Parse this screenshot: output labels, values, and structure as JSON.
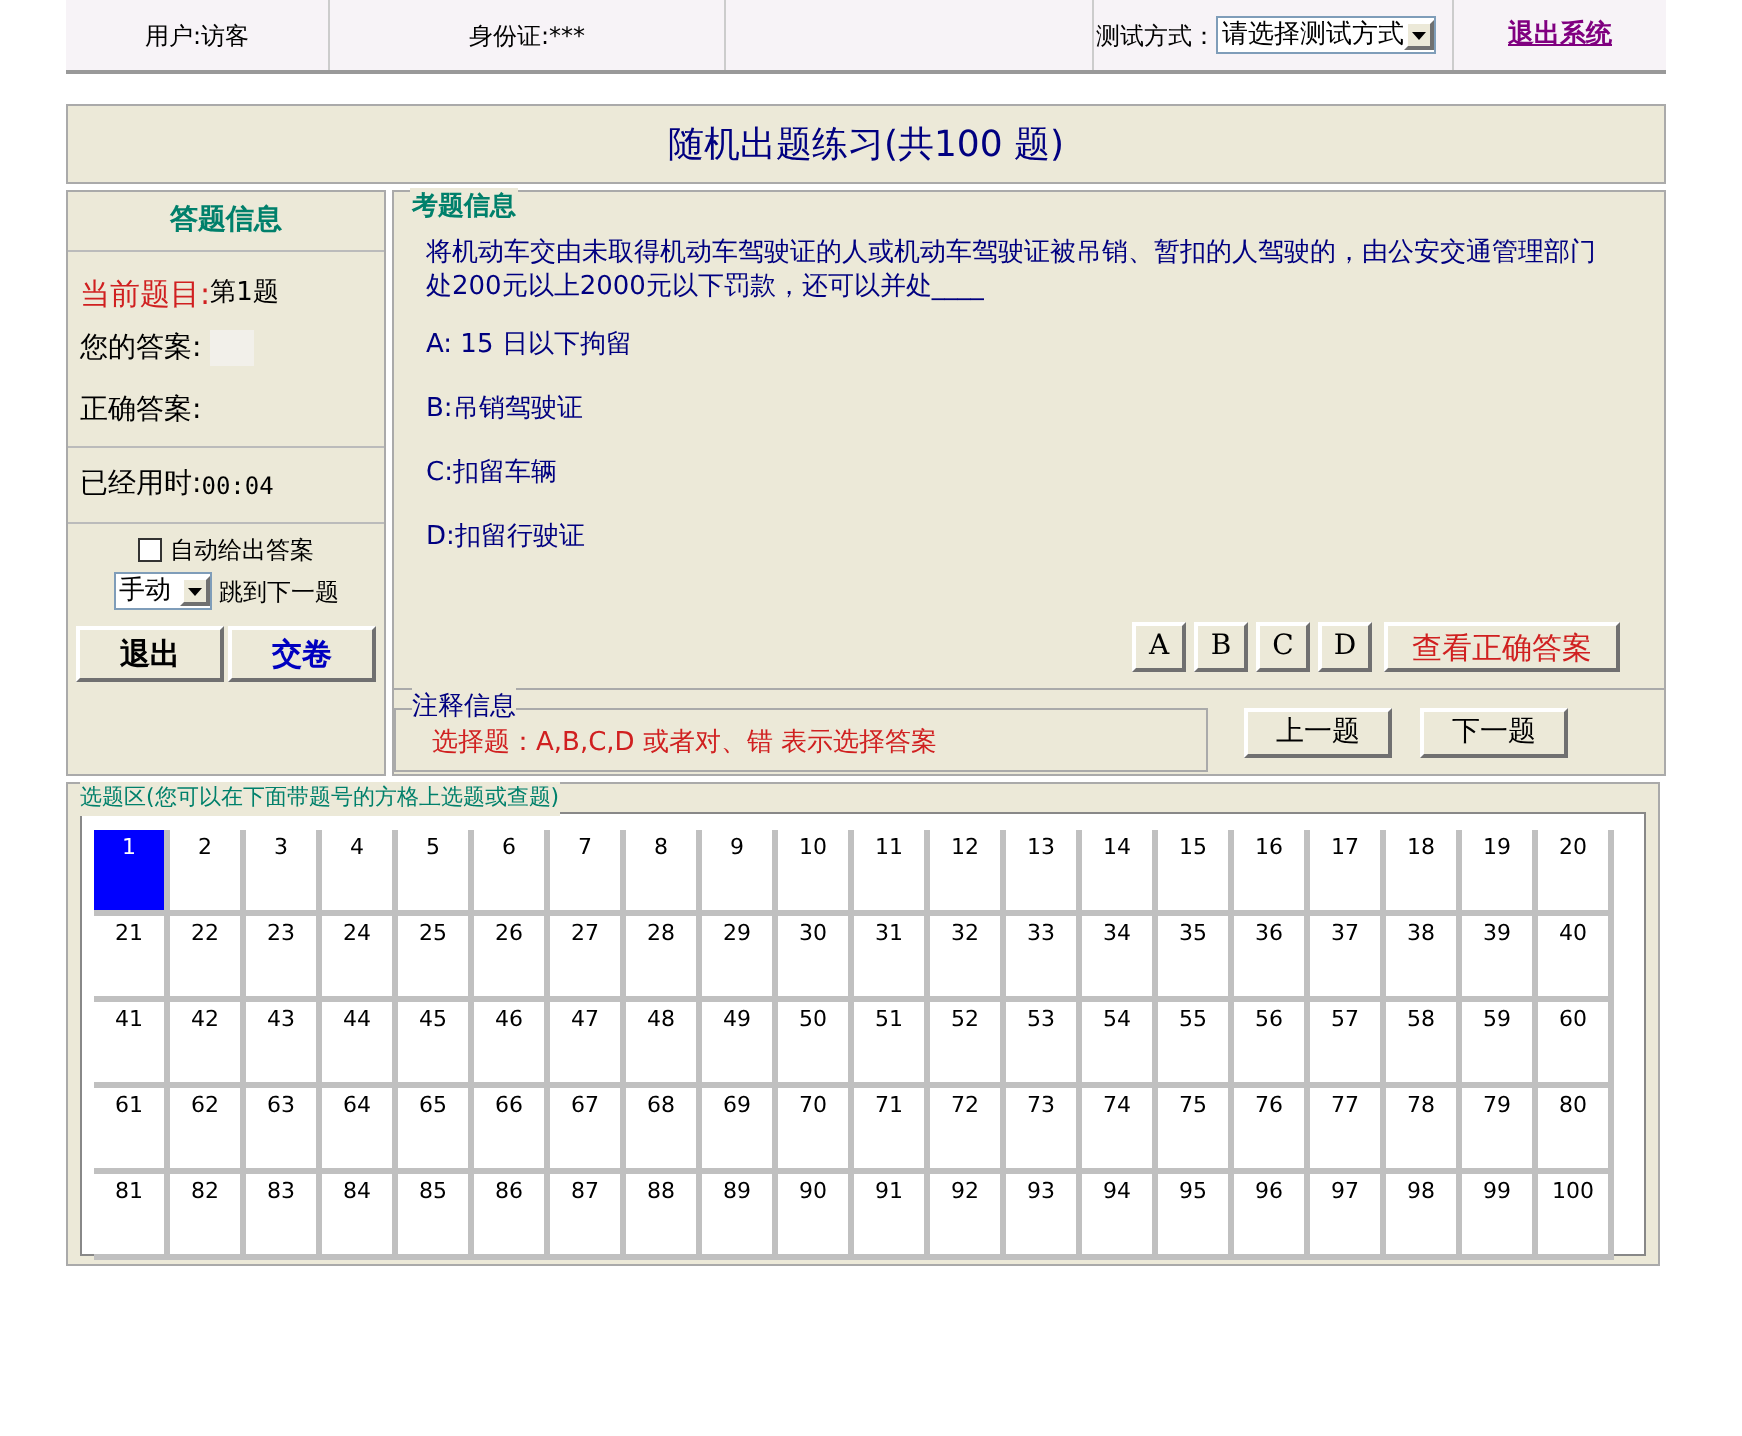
{
  "top_bar": {
    "user": "用户:访客",
    "id_card": "身份证:***",
    "test_mode_label": "测试方式：",
    "test_mode_select": "请选择测试方式",
    "logout_link": "退出系统"
  },
  "title": "随机出题练习(共100 题)",
  "answer_info": {
    "heading": "答题信息",
    "current_label": "当前题目:",
    "current_value": "第1题",
    "your_answer_label": "您的答案:",
    "correct_answer_label": "正确答案:",
    "elapsed_label": "已经用时:",
    "elapsed_value": "00:04",
    "auto_answer": {
      "label": "自动给出答案",
      "checked": false
    },
    "mode_select": "手动",
    "jump_label": "跳到下一题",
    "exit_button": "退出",
    "submit_button": "交卷"
  },
  "question": {
    "legend": "考题信息",
    "text": "将机动车交由未取得机动车驾驶证的人或机动车驾驶证被吊销、暂扣的人驾驶的，由公安交通管理部门处200元以上2000元以下罚款，还可以并处____",
    "options": [
      "A: 15 日以下拘留",
      "B:吊销驾驶证",
      "C:扣留车辆",
      "D:扣留行驶证"
    ],
    "answer_buttons": [
      "A",
      "B",
      "C",
      "D"
    ],
    "show_answer_button": "查看正确答案"
  },
  "notes": {
    "legend": "注释信息",
    "text": "选择题：A,B,C,D 或者对、错 表示选择答案"
  },
  "nav": {
    "prev_button": "上一题",
    "next_button": "下一题"
  },
  "grid": {
    "legend": "选题区(您可以在下面带题号的方格上选题或查题)",
    "cells": [
      {
        "label": "1",
        "selected": true
      },
      {
        "label": "2",
        "selected": false
      },
      {
        "label": "3",
        "selected": false
      },
      {
        "label": "4",
        "selected": false
      },
      {
        "label": "5",
        "selected": false
      },
      {
        "label": "6",
        "selected": false
      },
      {
        "label": "7",
        "selected": false
      },
      {
        "label": "8",
        "selected": false
      },
      {
        "label": "9",
        "selected": false
      },
      {
        "label": "10",
        "selected": false
      },
      {
        "label": "11",
        "selected": false
      },
      {
        "label": "12",
        "selected": false
      },
      {
        "label": "13",
        "selected": false
      },
      {
        "label": "14",
        "selected": false
      },
      {
        "label": "15",
        "selected": false
      },
      {
        "label": "16",
        "selected": false
      },
      {
        "label": "17",
        "selected": false
      },
      {
        "label": "18",
        "selected": false
      },
      {
        "label": "19",
        "selected": false
      },
      {
        "label": "20",
        "selected": false
      },
      {
        "label": "21",
        "selected": false
      },
      {
        "label": "22",
        "selected": false
      },
      {
        "label": "23",
        "selected": false
      },
      {
        "label": "24",
        "selected": false
      },
      {
        "label": "25",
        "selected": false
      },
      {
        "label": "26",
        "selected": false
      },
      {
        "label": "27",
        "selected": false
      },
      {
        "label": "28",
        "selected": false
      },
      {
        "label": "29",
        "selected": false
      },
      {
        "label": "30",
        "selected": false
      },
      {
        "label": "31",
        "selected": false
      },
      {
        "label": "32",
        "selected": false
      },
      {
        "label": "33",
        "selected": false
      },
      {
        "label": "34",
        "selected": false
      },
      {
        "label": "35",
        "selected": false
      },
      {
        "label": "36",
        "selected": false
      },
      {
        "label": "37",
        "selected": false
      },
      {
        "label": "38",
        "selected": false
      },
      {
        "label": "39",
        "selected": false
      },
      {
        "label": "40",
        "selected": false
      },
      {
        "label": "41",
        "selected": false
      },
      {
        "label": "42",
        "selected": false
      },
      {
        "label": "43",
        "selected": false
      },
      {
        "label": "44",
        "selected": false
      },
      {
        "label": "45",
        "selected": false
      },
      {
        "label": "46",
        "selected": false
      },
      {
        "label": "47",
        "selected": false
      },
      {
        "label": "48",
        "selected": false
      },
      {
        "label": "49",
        "selected": false
      },
      {
        "label": "50",
        "selected": false
      },
      {
        "label": "51",
        "selected": false
      },
      {
        "label": "52",
        "selected": false
      },
      {
        "label": "53",
        "selected": false
      },
      {
        "label": "54",
        "selected": false
      },
      {
        "label": "55",
        "selected": false
      },
      {
        "label": "56",
        "selected": false
      },
      {
        "label": "57",
        "selected": false
      },
      {
        "label": "58",
        "selected": false
      },
      {
        "label": "59",
        "selected": false
      },
      {
        "label": "60",
        "selected": false
      },
      {
        "label": "61",
        "selected": false
      },
      {
        "label": "62",
        "selected": false
      },
      {
        "label": "63",
        "selected": false
      },
      {
        "label": "64",
        "selected": false
      },
      {
        "label": "65",
        "selected": false
      },
      {
        "label": "66",
        "selected": false
      },
      {
        "label": "67",
        "selected": false
      },
      {
        "label": "68",
        "selected": false
      },
      {
        "label": "69",
        "selected": false
      },
      {
        "label": "70",
        "selected": false
      },
      {
        "label": "71",
        "selected": false
      },
      {
        "label": "72",
        "selected": false
      },
      {
        "label": "73",
        "selected": false
      },
      {
        "label": "74",
        "selected": false
      },
      {
        "label": "75",
        "selected": false
      },
      {
        "label": "76",
        "selected": false
      },
      {
        "label": "77",
        "selected": false
      },
      {
        "label": "78",
        "selected": false
      },
      {
        "label": "79",
        "selected": false
      },
      {
        "label": "80",
        "selected": false
      },
      {
        "label": "81",
        "selected": false
      },
      {
        "label": "82",
        "selected": false
      },
      {
        "label": "83",
        "selected": false
      },
      {
        "label": "84",
        "selected": false
      },
      {
        "label": "85",
        "selected": false
      },
      {
        "label": "86",
        "selected": false
      },
      {
        "label": "87",
        "selected": false
      },
      {
        "label": "88",
        "selected": false
      },
      {
        "label": "89",
        "selected": false
      },
      {
        "label": "90",
        "selected": false
      },
      {
        "label": "91",
        "selected": false
      },
      {
        "label": "92",
        "selected": false
      },
      {
        "label": "93",
        "selected": false
      },
      {
        "label": "94",
        "selected": false
      },
      {
        "label": "95",
        "selected": false
      },
      {
        "label": "96",
        "selected": false
      },
      {
        "label": "97",
        "selected": false
      },
      {
        "label": "98",
        "selected": false
      },
      {
        "label": "99",
        "selected": false
      },
      {
        "label": "100",
        "selected": false
      }
    ]
  }
}
